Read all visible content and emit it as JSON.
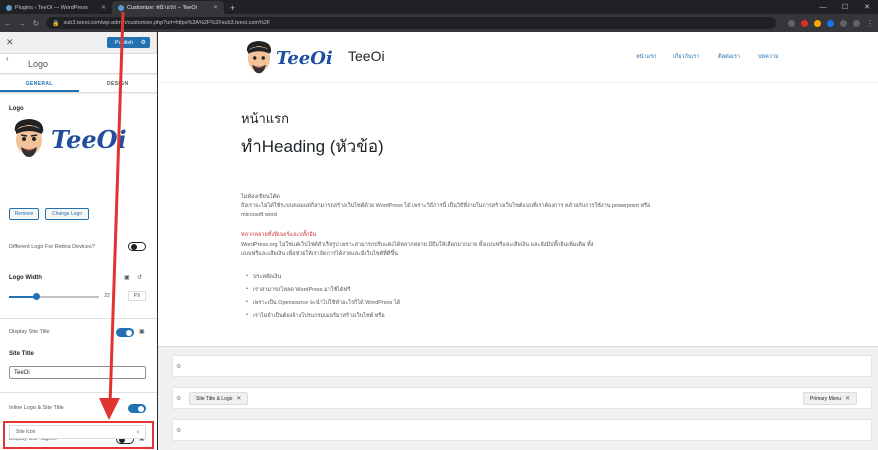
{
  "browser": {
    "tabs": [
      {
        "title": "Plugins ‹ TeeOi — WordPress",
        "active": false
      },
      {
        "title": "Customize: หน้าแรก – TeeOi",
        "active": true
      }
    ],
    "url": "sub3.teeoi.com/wp-admin/customize.php?url=https%3A%2F%2Fsub3.teeoi.com%2F",
    "new_tab": "+"
  },
  "sidebar": {
    "close": "✕",
    "publish_label": "Publish",
    "section_title": "Logo",
    "back": "‹",
    "tabs": {
      "general": "GENERAL",
      "design": "DESIGN"
    },
    "logo_label": "Logo",
    "logo_text": "TeeOi",
    "remove_label": "Remove",
    "change_logo_label": "Change Logo",
    "retina_label": "Different Logo For Retina Devices?",
    "logo_width_label": "Logo Width",
    "logo_width_value": "22",
    "logo_width_unit": "PX",
    "logo_width_fraction": 0.3,
    "display_site_title_label": "Display Site Title",
    "site_title_label": "Site Title",
    "site_title_value": "TeeOi",
    "inline_logo_label": "Inline Logo & Site Title",
    "display_tagline_label": "Display Site Tagline",
    "site_icon_label": "Site Icon"
  },
  "preview": {
    "brand_logo_text": "TeeOi",
    "brand_title": "TeeOi",
    "menu": [
      "หน้าแรก",
      "เกี่ยวกับเรา",
      "ติดต่อเรา",
      "บทความ"
    ],
    "page_title": "หน้าแรก",
    "heading": "ทำHeading (หัวข้อ)",
    "para1_title": "ไม่ต้องเขียนโค้ด",
    "para1": "ถึงเราจะไม่ได้ใช้ระบบคอมแต่ก็สามารถสร้างเว็บไซต์ด้วย WordPress ได้ เพราะวิธีการนี้ เป็นวิธีที่ง่ายในการสร้างเว็บไซต์แบบที่เราต้องการ คล้ายกับการใช้งาน powerpoint หรือ",
    "para1_end": "microsoft word",
    "red_heading": "หลากหลายทั้งฟีเจอร์และปลั๊กอิน",
    "para2": "WordPress.org ไม่ใช่แค่เว็บไซต์สำเร็จรูป เพราะสามารถปรับแต่งได้หลากหลาย มีธีมให้เลือกมากมาย ทั้งแบบฟรีและเสียเงิน และยังมีปลั๊กอินเพิ่มเติม ทั้ง",
    "para2_end": "แบบฟรีและเสียเงิน เพื่อช่วยให้เราจัดการได้ง่ายและมีเว็บไซต์ที่ดีขึ้น",
    "bullets": [
      "ประหยัดเงิน",
      "เราสามารถโหลด WordPress มาใช้ได้ฟรี",
      "เพราะเป็น Opensource จะนำไปใช้ทำอะไรก็ได้ WordPress ได้",
      "เราไม่จำเป็นต้องจ้างโปรแกรมเมอร์มาสร้างเว็บไซต์ หรือ"
    ],
    "builder_chip1": "Site Title & Logo",
    "builder_chip2": "Primary Menu"
  },
  "colors": {
    "accent": "#2271b1",
    "annotation": "#e23333"
  }
}
